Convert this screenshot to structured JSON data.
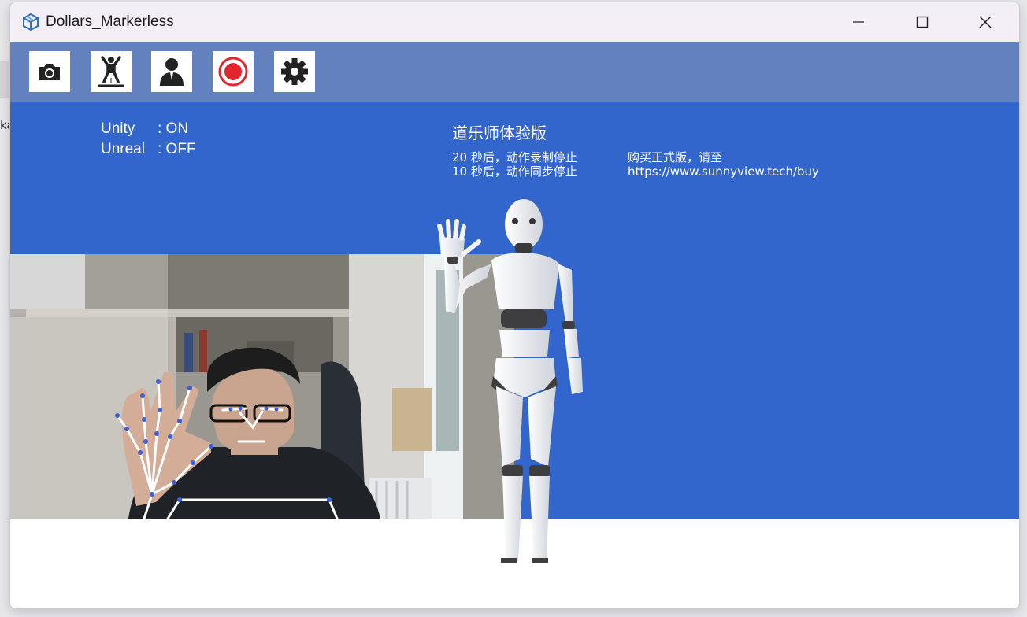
{
  "window": {
    "title": "Dollars_Markerless",
    "controls": [
      "minimize-icon",
      "maximize-icon",
      "close-icon"
    ]
  },
  "toolbar": {
    "buttons": [
      {
        "name": "camera",
        "icon": "camera-icon"
      },
      {
        "name": "pose",
        "icon": "body-pose-icon"
      },
      {
        "name": "character",
        "icon": "person-icon"
      },
      {
        "name": "record",
        "icon": "record-icon"
      },
      {
        "name": "settings",
        "icon": "gear-icon"
      }
    ]
  },
  "status": {
    "unity_label": "Unity",
    "unity_value": ": ON",
    "unreal_label": "Unreal",
    "unreal_value": ": OFF"
  },
  "trial": {
    "title": "道乐师体验版",
    "record_notice": "20 秒后，动作录制停止",
    "sync_notice": "10 秒后，动作同步停止",
    "buy_prompt": "购买正式版，请至",
    "buy_url": "https://www.sunnyview.tech/buy"
  },
  "colors": {
    "toolbar_bg": "#6381bf",
    "scene_bg": "#3366cc",
    "record_red": "#e3262e",
    "tracking_points": "#3b5fd6"
  }
}
